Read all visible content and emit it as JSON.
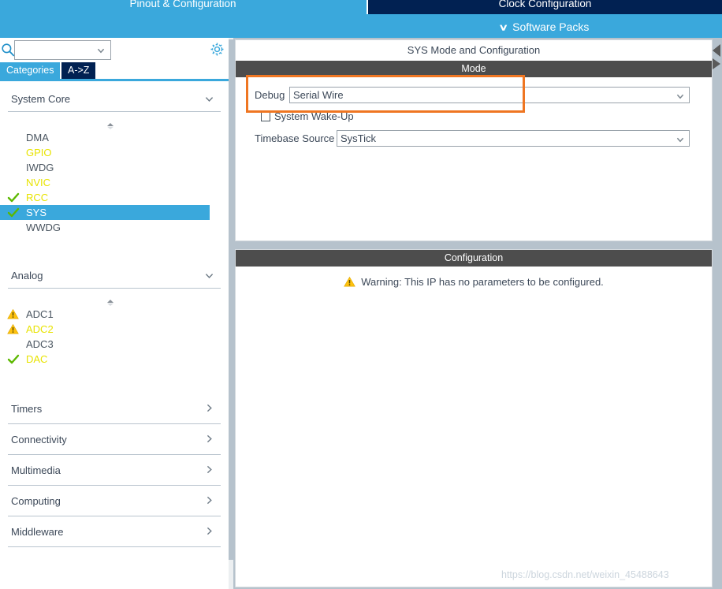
{
  "topbar": {
    "tab_pinout": "Pinout & Configuration",
    "tab_clock": "Clock Configuration",
    "software_packs": "Software Packs",
    "chevron": "∨",
    "colors": {
      "light_blue": "#3aa8dc",
      "navy": "#012152",
      "white": "#ffffff"
    }
  },
  "sidebar": {
    "search": {
      "value": "",
      "placeholder": "",
      "icon": "search-icon",
      "arrow": "chevron-down-icon"
    },
    "gear_icon": "gear-icon",
    "tabs": [
      {
        "label": "Categories",
        "active": true
      },
      {
        "label": "A->Z",
        "active": false
      }
    ],
    "sections": [
      {
        "title": "System Core",
        "expanded": true,
        "chevron": "chevron-down-icon",
        "items": [
          {
            "label": "DMA",
            "mark": "none",
            "color": "#4a5560"
          },
          {
            "label": "GPIO",
            "mark": "none",
            "color": "#e8e300"
          },
          {
            "label": "IWDG",
            "mark": "none",
            "color": "#4a5560"
          },
          {
            "label": "NVIC",
            "mark": "none",
            "color": "#e8e300"
          },
          {
            "label": "RCC",
            "mark": "check",
            "color": "#e8e300"
          },
          {
            "label": "SYS",
            "mark": "check",
            "color": "#ffffff",
            "selected": true
          },
          {
            "label": "WWDG",
            "mark": "none",
            "color": "#4a5560"
          }
        ]
      },
      {
        "title": "Analog",
        "expanded": true,
        "chevron": "chevron-down-icon",
        "items": [
          {
            "label": "ADC1",
            "mark": "warning",
            "color": "#4a5560"
          },
          {
            "label": "ADC2",
            "mark": "warning",
            "color": "#e8e300"
          },
          {
            "label": "ADC3",
            "mark": "none",
            "color": "#4a5560"
          },
          {
            "label": "DAC",
            "mark": "check",
            "color": "#e8e300"
          }
        ]
      }
    ],
    "categories": [
      {
        "label": "Timers",
        "chevron": "chevron-right-icon"
      },
      {
        "label": "Connectivity",
        "chevron": "chevron-right-icon"
      },
      {
        "label": "Multimedia",
        "chevron": "chevron-right-icon"
      },
      {
        "label": "Computing",
        "chevron": "chevron-right-icon"
      },
      {
        "label": "Middleware",
        "chevron": "chevron-right-icon"
      }
    ]
  },
  "main": {
    "mode_card": {
      "caption": "SYS Mode and Configuration",
      "band": "Mode",
      "debug": {
        "label": "Debug",
        "value": "Serial Wire",
        "arrow": "chevron-down-icon"
      },
      "system_wake_up": {
        "label": "System Wake-Up",
        "checked": false
      },
      "timebase": {
        "label": "Timebase Source",
        "value": "SysTick",
        "arrow": "chevron-down-icon"
      },
      "highlight_color": "#ef7622"
    },
    "config_card": {
      "band": "Configuration",
      "warning_icon": "warning-triangle-icon",
      "warning_text": "Warning: This IP has no parameters to be configured."
    }
  },
  "edge_arrows": [
    {
      "name": "panel-collapse-arrow-up"
    },
    {
      "name": "panel-collapse-arrow-down"
    }
  ],
  "watermark": "https://blog.csdn.net/weixin_45488643"
}
